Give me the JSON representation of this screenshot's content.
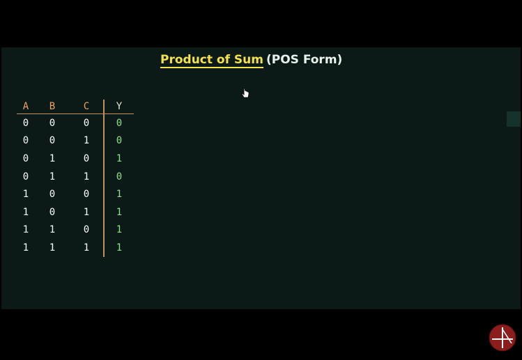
{
  "title": {
    "main": "Product of Sum",
    "sub": "(POS Form)"
  },
  "truth_table": {
    "headers": [
      "A",
      "B",
      "C",
      "Y"
    ],
    "rows": [
      [
        "0",
        "0",
        "0",
        "0"
      ],
      [
        "0",
        "0",
        "1",
        "0"
      ],
      [
        "0",
        "1",
        "0",
        "1"
      ],
      [
        "0",
        "1",
        "1",
        "0"
      ],
      [
        "1",
        "0",
        "0",
        "1"
      ],
      [
        "1",
        "0",
        "1",
        "1"
      ],
      [
        "1",
        "1",
        "0",
        "1"
      ],
      [
        "1",
        "1",
        "1",
        "1"
      ]
    ]
  },
  "colors": {
    "board": "#0b1a16",
    "title_underlined": "#f5e14a",
    "header_text": "#f0a35b",
    "output_values": "#8fe08e",
    "logo": "#8c1d1d"
  },
  "icons": {
    "cursor": "hand-cursor-icon",
    "logo": "channel-logo-icon"
  }
}
